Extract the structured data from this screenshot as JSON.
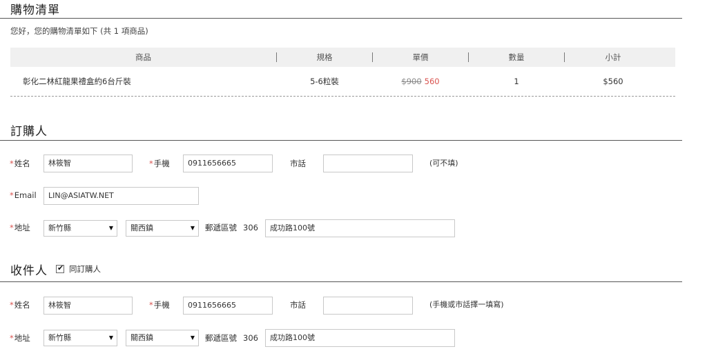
{
  "cart": {
    "title": "購物清單",
    "greeting": "您好，您的購物清單如下 (共 1 項商品)",
    "headers": {
      "product": "商品",
      "spec": "規格",
      "price": "單價",
      "qty": "數量",
      "subtotal": "小計"
    },
    "sep": "|",
    "item": {
      "name": "彰化二林紅龍果禮盒約6台斤裝",
      "spec": "5-6粒裝",
      "old_price": "$900",
      "new_price": "560",
      "qty": "1",
      "subtotal": "$560"
    }
  },
  "buyer": {
    "title": "訂購人",
    "req_mark": "*",
    "name_label": "姓名",
    "name_value": "林筱智",
    "mobile_label": "手機",
    "mobile_value": "0911656665",
    "phone_label": "市話",
    "phone_value": "",
    "phone_note": "(可不填)",
    "email_label": "Email",
    "email_value": "LIN@ASIATW.NET",
    "address_label": "地址",
    "county": "新竹縣",
    "district": "關西鎮",
    "zip_label": "郵遞區號",
    "zip": "306",
    "street": "成功路100號"
  },
  "receiver": {
    "title": "收件人",
    "same_as_buyer_label": "同訂購人",
    "same_as_buyer_checked": true,
    "req_mark": "*",
    "name_label": "姓名",
    "name_value": "林筱智",
    "mobile_label": "手機",
    "mobile_value": "0911656665",
    "phone_label": "市話",
    "phone_value": "",
    "phone_note": "(手機或市話擇一填寫)",
    "address_label": "地址",
    "county": "新竹縣",
    "district": "關西鎮",
    "zip_label": "郵遞區號",
    "zip": "306",
    "street": "成功路100號"
  },
  "icons": {
    "dropdown": "chevron-down-icon",
    "check": "checkmark-icon"
  },
  "colors": {
    "required": "#d9534f",
    "header_bg": "#f0f0f0",
    "sale_price": "#d9534f"
  }
}
